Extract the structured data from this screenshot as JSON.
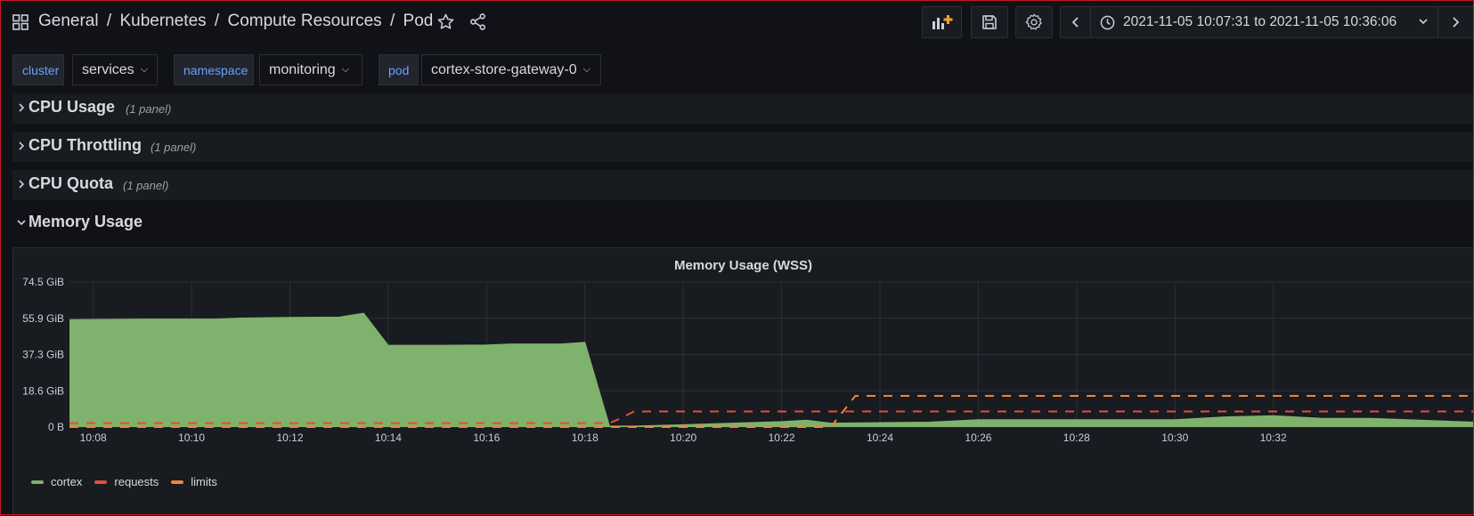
{
  "breadcrumb": {
    "folder": "General",
    "sep1": "/",
    "path1": "Kubernetes",
    "sep2": "/",
    "path2": "Compute Resources",
    "sep3": "/",
    "dashboard": "Pod"
  },
  "time_range": {
    "label": "2021-11-05 10:07:31 to 2021-11-05 10:36:06"
  },
  "variables": [
    {
      "label": "cluster",
      "value": "services"
    },
    {
      "label": "namespace",
      "value": "monitoring"
    },
    {
      "label": "pod",
      "value": "cortex-store-gateway-0"
    }
  ],
  "rows": [
    {
      "title": "CPU Usage",
      "count": "(1 panel)",
      "collapsed": true
    },
    {
      "title": "CPU Throttling",
      "count": "(1 panel)",
      "collapsed": true
    },
    {
      "title": "CPU Quota",
      "count": "(1 panel)",
      "collapsed": true
    },
    {
      "title": "Memory Usage",
      "collapsed": false
    }
  ],
  "panel": {
    "title": "Memory Usage (WSS)"
  },
  "icons": {
    "apps": "apps-grid-icon",
    "star": "star-icon",
    "share": "share-icon",
    "add_panel": "add-panel-icon",
    "save": "save-icon",
    "settings": "gear-icon",
    "clock": "clock-icon"
  },
  "colors": {
    "cortex": "#7eb26d",
    "requests": "#e24d42",
    "limits": "#ef843c",
    "variable_label": "#6e9fff",
    "add_panel_accent": "#f2a12c"
  },
  "chart_data": {
    "type": "area",
    "title": "Memory Usage (WSS)",
    "xlabel": "",
    "ylabel": "",
    "x_ticks": [
      "10:08",
      "10:10",
      "10:12",
      "10:14",
      "10:16",
      "10:18",
      "10:20",
      "10:22",
      "10:24",
      "10:26",
      "10:28",
      "10:30",
      "10:32"
    ],
    "y_ticks": [
      "0 B",
      "18.6 GiB",
      "37.3 GiB",
      "55.9 GiB",
      "74.5 GiB"
    ],
    "y_unit": "GiB",
    "ylim": [
      0,
      74.5
    ],
    "xlim": [
      "10:07:31",
      "10:36:06"
    ],
    "grid": true,
    "legend_position": "bottom-left",
    "series": [
      {
        "name": "cortex",
        "style": "area",
        "points": [
          [
            "10:07:31",
            55.2
          ],
          [
            "10:09:00",
            55.5
          ],
          [
            "10:10:30",
            55.5
          ],
          [
            "10:11:00",
            56.0
          ],
          [
            "10:12:00",
            56.3
          ],
          [
            "10:13:00",
            56.5
          ],
          [
            "10:13:30",
            58.5
          ],
          [
            "10:14:00",
            42.0
          ],
          [
            "10:15:00",
            42.0
          ],
          [
            "10:16:00",
            42.2
          ],
          [
            "10:16:30",
            42.7
          ],
          [
            "10:17:30",
            42.7
          ],
          [
            "10:18:00",
            43.5
          ],
          [
            "10:18:30",
            0.5
          ],
          [
            "10:19:00",
            0.5
          ],
          [
            "10:20:00",
            1.2
          ],
          [
            "10:21:00",
            2.0
          ],
          [
            "10:22:00",
            2.8
          ],
          [
            "10:22:30",
            3.5
          ],
          [
            "10:23:00",
            2.0
          ],
          [
            "10:25:00",
            2.5
          ],
          [
            "10:26:00",
            3.8
          ],
          [
            "10:30:00",
            3.8
          ],
          [
            "10:31:00",
            5.2
          ],
          [
            "10:32:00",
            5.8
          ],
          [
            "10:33:00",
            4.5
          ],
          [
            "10:34:00",
            4.5
          ],
          [
            "10:36:06",
            2.5
          ]
        ]
      },
      {
        "name": "requests",
        "style": "dashed",
        "points": [
          [
            "10:07:31",
            2.0
          ],
          [
            "10:18:30",
            2.0
          ],
          [
            "10:18:40",
            3.8
          ],
          [
            "10:19:00",
            8.0
          ],
          [
            "10:36:06",
            8.0
          ]
        ]
      },
      {
        "name": "limits",
        "style": "dashed",
        "points": [
          [
            "10:07:31",
            0
          ],
          [
            "10:23:00",
            0
          ],
          [
            "10:23:30",
            16.0
          ],
          [
            "10:36:06",
            16.0
          ]
        ]
      }
    ]
  }
}
